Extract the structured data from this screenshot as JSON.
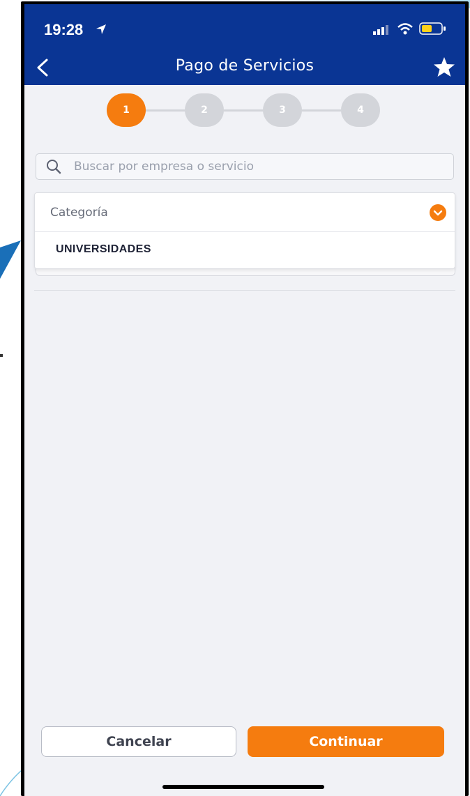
{
  "status_bar": {
    "time": "19:28"
  },
  "header": {
    "title": "Pago de Servicios"
  },
  "stepper": {
    "steps": [
      "1",
      "2",
      "3",
      "4"
    ],
    "active_step": 1
  },
  "search": {
    "placeholder": "Buscar por empresa o servicio",
    "value": ""
  },
  "category": {
    "label": "Categoría",
    "options": [
      "UNIVERSIDADES"
    ]
  },
  "buttons": {
    "cancel_label": "Cancelar",
    "continue_label": "Continuar"
  },
  "colors": {
    "brand_blue": "#0a3594",
    "accent_orange": "#f57c0f",
    "inactive_step": "#d3d5da",
    "background": "#f1f2f6"
  },
  "icons": {
    "back": "chevron-left-icon",
    "favorite": "star-icon",
    "search": "search-icon",
    "dropdown": "chevron-down-icon",
    "location": "location-arrow-icon",
    "signal": "signal-icon",
    "wifi": "wifi-icon",
    "battery": "battery-icon"
  }
}
